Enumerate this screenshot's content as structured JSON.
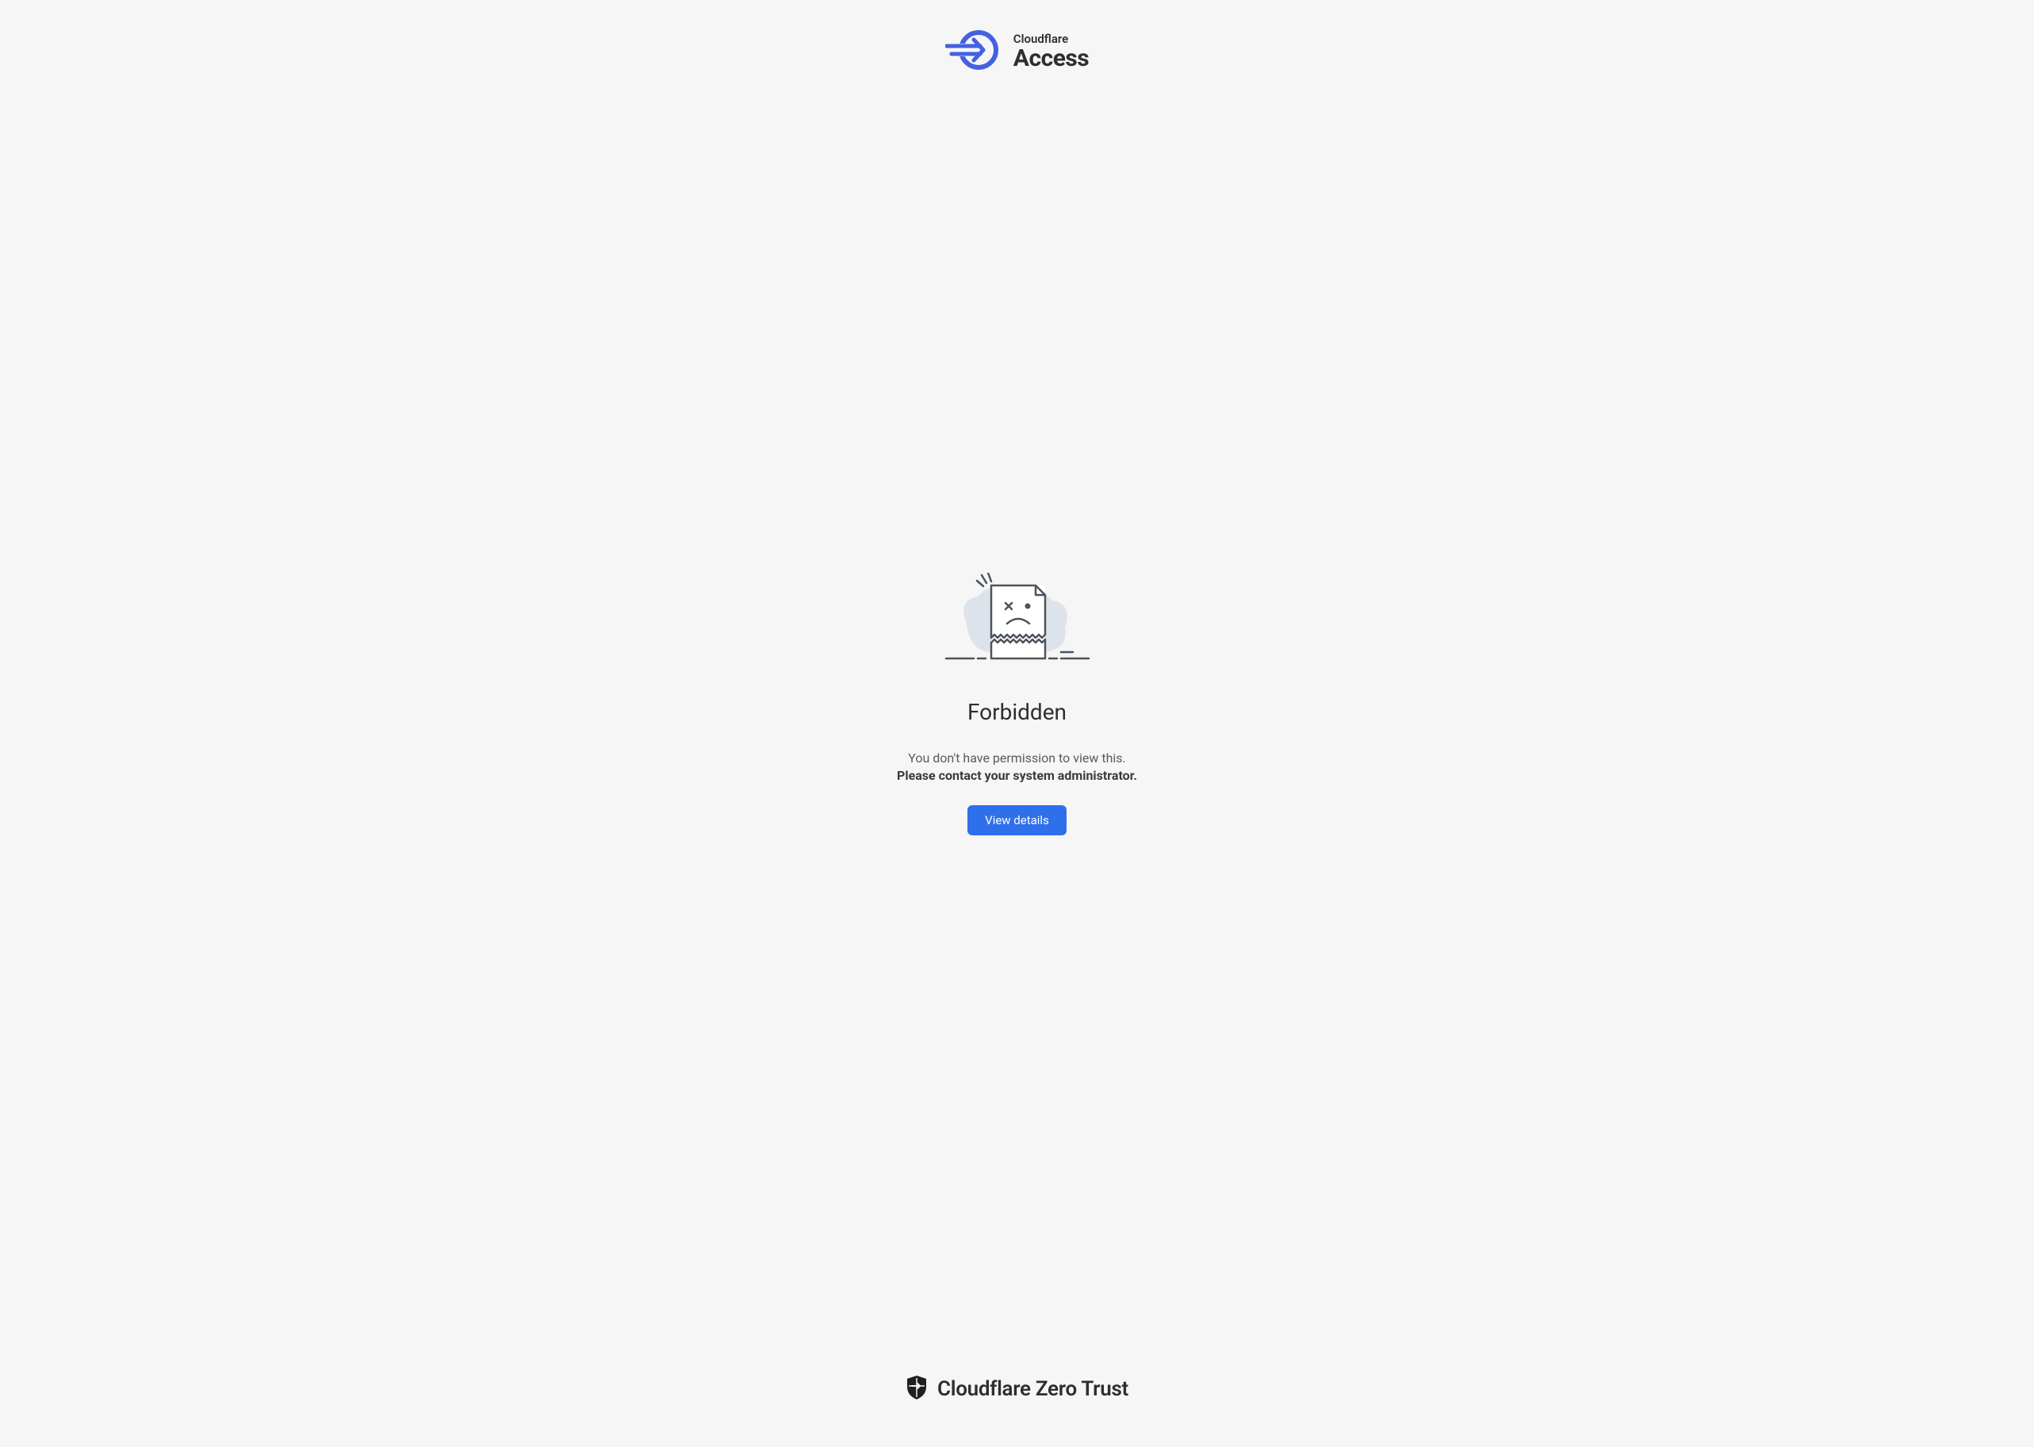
{
  "header": {
    "brand_small": "Cloudflare",
    "brand_large": "Access"
  },
  "error": {
    "title": "Forbidden",
    "message": "You don't have permission to view this.",
    "message_bold": "Please contact your system administrator.",
    "button_label": "View details"
  },
  "footer": {
    "text": "Cloudflare Zero Trust"
  }
}
